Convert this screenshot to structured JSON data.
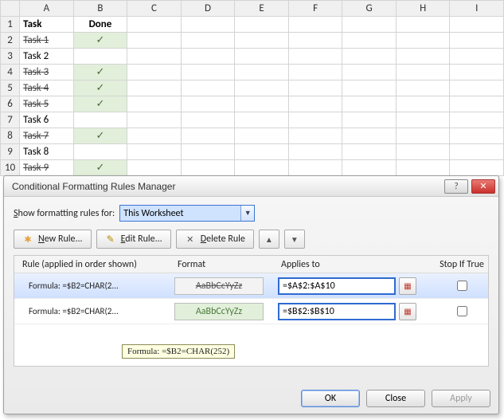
{
  "sheet": {
    "columns": [
      "A",
      "B",
      "C",
      "D",
      "E",
      "F",
      "G",
      "H",
      "I"
    ],
    "header": {
      "a": "Task",
      "b": "Done"
    },
    "rows": [
      {
        "n": 1,
        "a": "Task",
        "b": "Done",
        "bold": true
      },
      {
        "n": 2,
        "a": "Task 1",
        "b": "✓",
        "done": true
      },
      {
        "n": 3,
        "a": "Task 2",
        "b": ""
      },
      {
        "n": 4,
        "a": "Task 3",
        "b": "✓",
        "done": true
      },
      {
        "n": 5,
        "a": "Task 4",
        "b": "✓",
        "done": true
      },
      {
        "n": 6,
        "a": "Task 5",
        "b": "✓",
        "done": true
      },
      {
        "n": 7,
        "a": "Task 6",
        "b": ""
      },
      {
        "n": 8,
        "a": "Task 7",
        "b": "✓",
        "done": true
      },
      {
        "n": 9,
        "a": "Task 8",
        "b": ""
      },
      {
        "n": 10,
        "a": "Task 9",
        "b": "✓",
        "done": true
      }
    ]
  },
  "dialog": {
    "title": "Conditional Formatting Rules Manager",
    "show_label_pre": "S",
    "show_label_mid": "how formatting rules for:",
    "scope_value": "This Worksheet",
    "buttons": {
      "new": "New Rule...",
      "edit": "Edit Rule...",
      "delete": "Delete Rule"
    },
    "headers": {
      "rule": "Rule (applied in order shown)",
      "format": "Format",
      "applies": "Applies to",
      "stop": "Stop If True"
    },
    "rules": [
      {
        "name": "Formula: =$B2=CHAR(2...",
        "preview": "AaBbCcYyZz",
        "style": "strike",
        "applies": "=$A$2:$A$10",
        "stop": false
      },
      {
        "name": "Formula: =$B2=CHAR(2...",
        "preview": "AaBbCcYyZz",
        "style": "green",
        "applies": "=$B$2:$B$10",
        "stop": false
      }
    ],
    "tooltip": "Formula: =$B2=CHAR(252)",
    "footer": {
      "ok": "OK",
      "close": "Close",
      "apply": "Apply"
    }
  }
}
